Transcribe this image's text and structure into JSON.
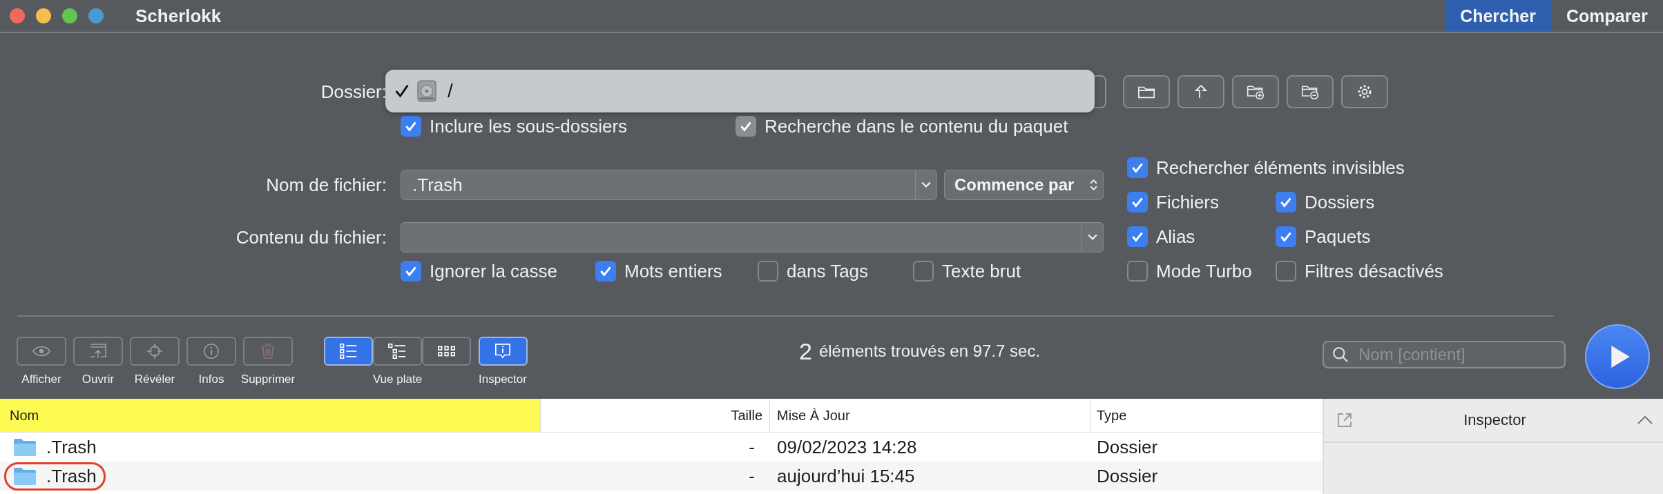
{
  "window": {
    "title": "Scherlokk"
  },
  "mode_tabs": [
    {
      "label": "Chercher",
      "selected": true
    },
    {
      "label": "Comparer",
      "selected": false
    }
  ],
  "folder": {
    "label": "Dossier:",
    "menu_item": {
      "text": "/",
      "checked": true
    }
  },
  "folder_options": [
    {
      "label": "Inclure les sous-dossiers",
      "checked": true,
      "disabled": false
    },
    {
      "label": "Recherche dans le contenu du paquet",
      "checked": true,
      "disabled": true
    }
  ],
  "filename": {
    "label": "Nom de fichier:",
    "value": ".Trash",
    "match_mode": "Commence par"
  },
  "content": {
    "label": "Contenu du fichier:"
  },
  "content_options": [
    {
      "label": "Ignorer la casse",
      "checked": true
    },
    {
      "label": "Mots entiers",
      "checked": true
    },
    {
      "label": "dans Tags",
      "checked": false
    },
    {
      "label": "Texte brut",
      "checked": false
    }
  ],
  "filters": [
    {
      "label": "Rechercher éléments invisibles",
      "checked": true
    },
    {
      "label": "Fichiers",
      "checked": true
    },
    {
      "label": "Dossiers",
      "checked": true
    },
    {
      "label": "Alias",
      "checked": true
    },
    {
      "label": "Paquets",
      "checked": true
    },
    {
      "label": "Mode Turbo",
      "checked": false
    },
    {
      "label": "Filtres désactivés",
      "checked": false
    }
  ],
  "toolbar": [
    {
      "label": "Afficher",
      "disabled": true
    },
    {
      "label": "Ouvrir",
      "disabled": true
    },
    {
      "label": "Révéler",
      "disabled": true
    },
    {
      "label": "Infos",
      "disabled": true
    },
    {
      "label": "Supprimer",
      "disabled": true
    }
  ],
  "view": {
    "label": "Vue plate",
    "modes": [
      {
        "selected": true
      },
      {
        "selected": false
      },
      {
        "selected": false
      }
    ]
  },
  "inspector_toggle": {
    "label": "Inspector",
    "on": true
  },
  "status": {
    "count": "2",
    "text": "éléments trouvés en 97.7 sec."
  },
  "search": {
    "placeholder": "Nom [contient]"
  },
  "table": {
    "columns": [
      {
        "label": "Nom",
        "highlighted": true
      },
      {
        "label": "Taille",
        "highlighted": false
      },
      {
        "label": "Mise À Jour",
        "highlighted": false
      },
      {
        "label": "Type",
        "highlighted": false
      }
    ],
    "rows": [
      {
        "name": ".Trash",
        "size": "-",
        "modified": "09/02/2023 14:28",
        "type": "Dossier",
        "circled": false
      },
      {
        "name": ".Trash",
        "size": "-",
        "modified": "aujourd’hui 15:45",
        "type": "Dossier",
        "circled": true
      }
    ]
  },
  "inspector": {
    "title": "Inspector"
  }
}
